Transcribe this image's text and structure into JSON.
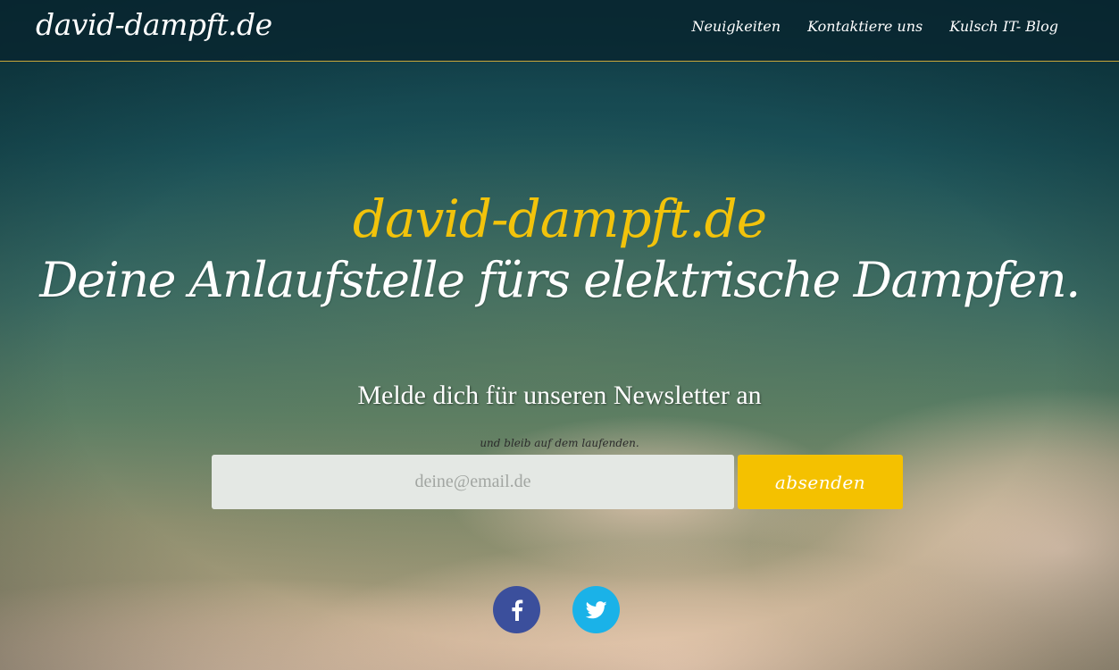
{
  "navbar": {
    "brand": "david-dampft.de",
    "links": [
      {
        "label": "Neuigkeiten"
      },
      {
        "label": "Kontaktiere uns"
      },
      {
        "label": "Kulsch IT- Blog"
      }
    ]
  },
  "hero": {
    "brand": "david-dampft.de",
    "tagline": "Deine Anlaufstelle fürs elektrische Dampfen."
  },
  "newsletter": {
    "heading": "Melde dich für unseren Newsletter an",
    "subheading": "und bleib auf dem laufenden.",
    "email_placeholder": "deine@email.de",
    "email_value": "",
    "submit_label": "absenden"
  },
  "social": [
    {
      "icon": "facebook-icon"
    },
    {
      "icon": "twitter-icon"
    }
  ],
  "colors": {
    "accent": "#f4c100",
    "facebook": "#3b4f9c",
    "twitter": "#1ab2e8",
    "navbar_border": "#c9a73a"
  }
}
